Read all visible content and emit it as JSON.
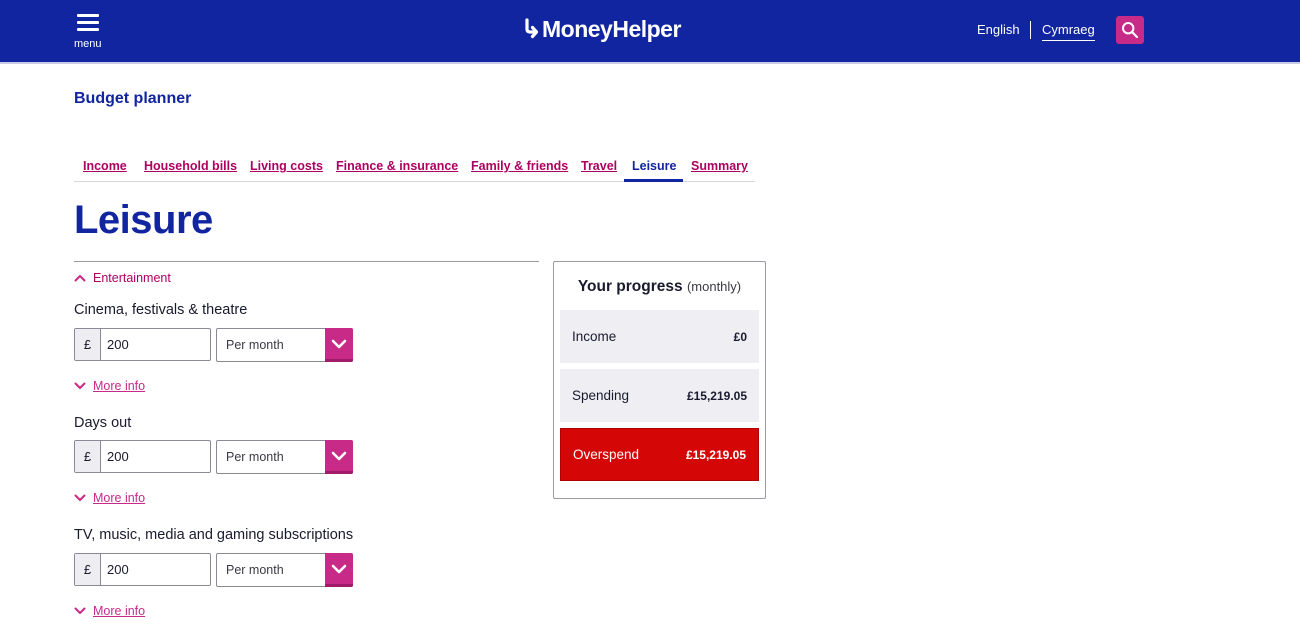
{
  "header": {
    "menu_label": "menu",
    "logo_text": "MoneyHelper",
    "languages": {
      "english": "English",
      "welsh": "Cymraeg"
    },
    "icons": {
      "menu": "hamburger-icon",
      "search": "search-icon"
    },
    "colors": {
      "header_bg": "#1125a0",
      "accent": "#c82a87"
    }
  },
  "page_title": "Budget planner",
  "tabs": [
    {
      "label": "Income"
    },
    {
      "label": "Household bills"
    },
    {
      "label": "Living costs"
    },
    {
      "label": "Finance & insurance"
    },
    {
      "label": "Family & friends"
    },
    {
      "label": "Travel"
    },
    {
      "label": "Leisure",
      "active": true
    },
    {
      "label": "Summary"
    }
  ],
  "main": {
    "heading": "Leisure",
    "section_label": "Entertainment",
    "fields": [
      {
        "label": "Cinema, festivals & theatre",
        "currency": "£",
        "value": "200",
        "frequency": "Per month",
        "more_info": "More info"
      },
      {
        "label": "Days out",
        "currency": "£",
        "value": "200",
        "frequency": "Per month",
        "more_info": "More info"
      },
      {
        "label": "TV, music, media and gaming subscriptions",
        "currency": "£",
        "value": "200",
        "frequency": "Per month",
        "more_info": "More info"
      }
    ]
  },
  "progress": {
    "title": "Your progress",
    "subtitle": "(monthly)",
    "rows": [
      {
        "label": "Income",
        "amount": "£0"
      },
      {
        "label": "Spending",
        "amount": "£15,219.05"
      },
      {
        "label": "Overspend",
        "amount": "£15,219.05",
        "color": "#d40606"
      }
    ]
  }
}
